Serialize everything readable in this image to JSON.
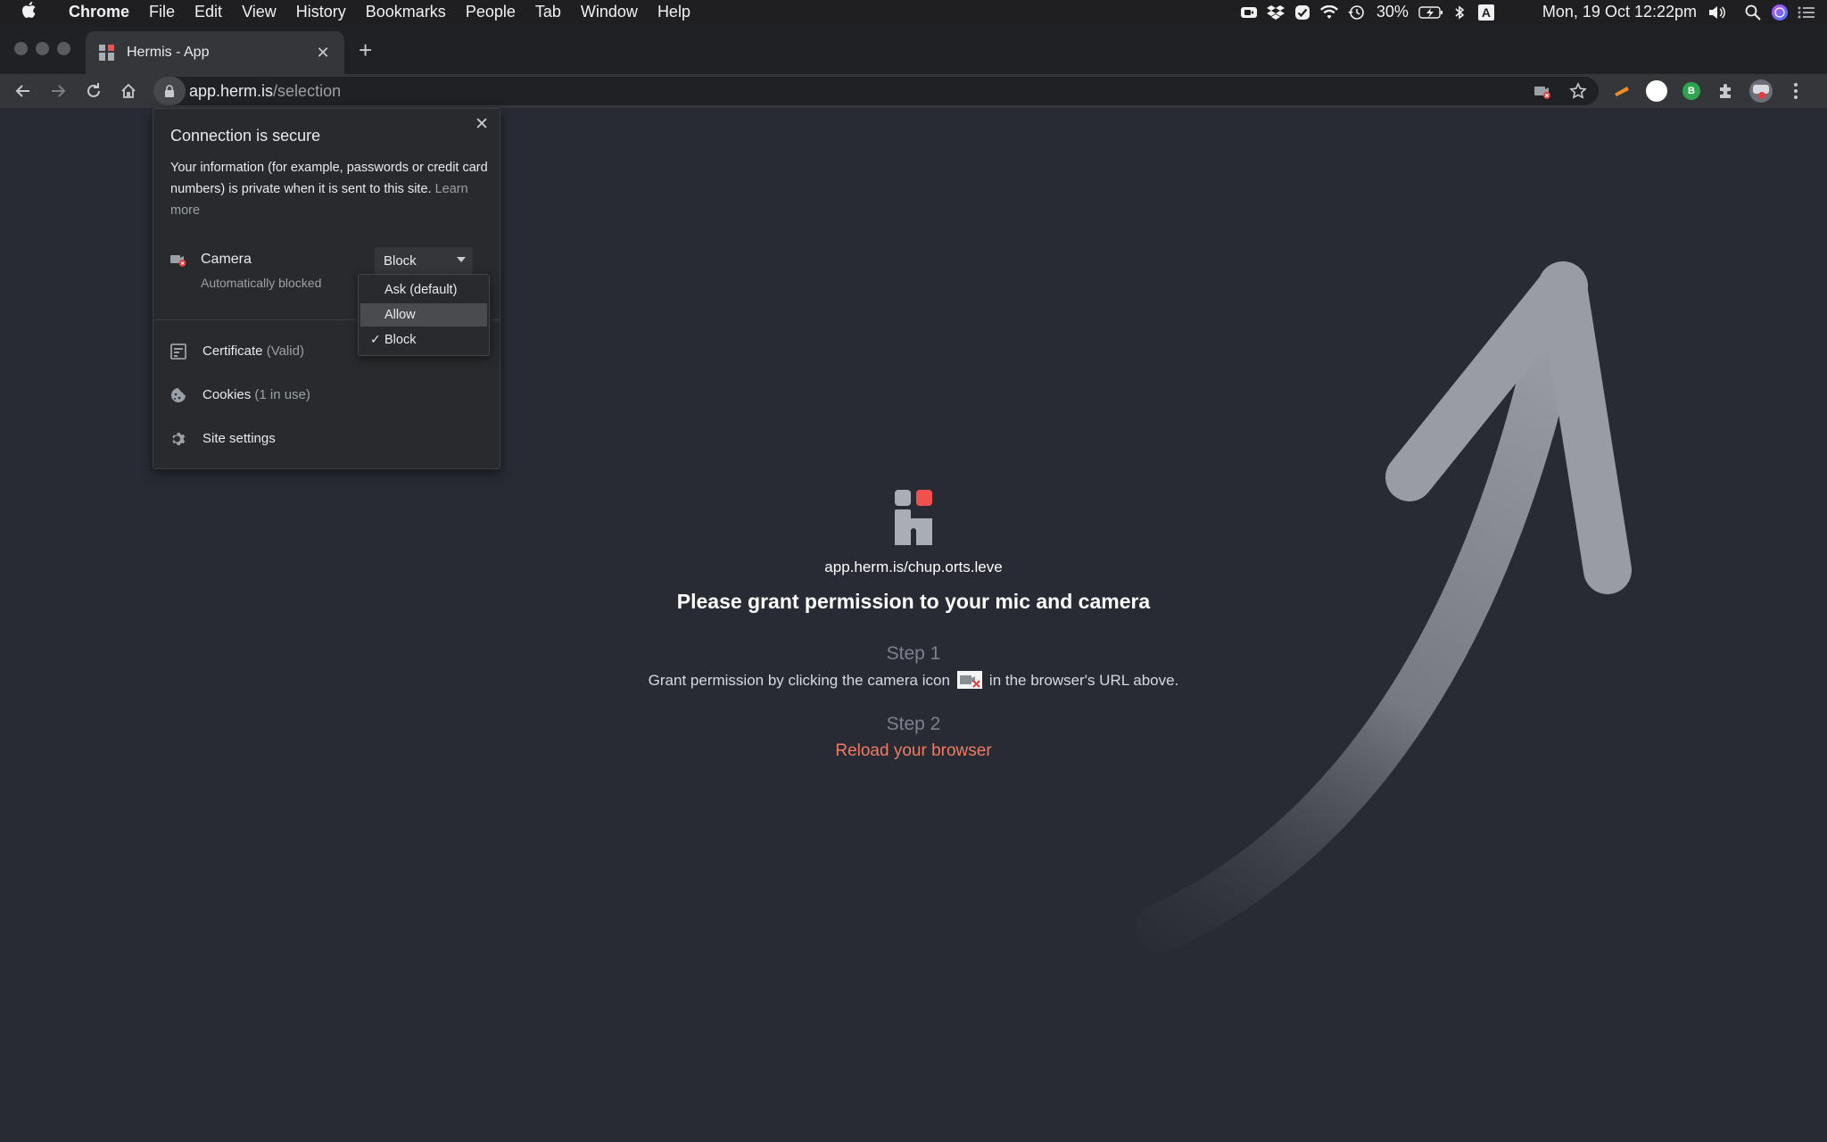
{
  "menubar": {
    "app": "Chrome",
    "items": [
      "File",
      "Edit",
      "View",
      "History",
      "Bookmarks",
      "People",
      "Tab",
      "Window",
      "Help"
    ],
    "battery": "30%",
    "datetime": "Mon, 19 Oct 12:22pm",
    "keyboard_indicator": "A",
    "status_icons": [
      "camera-icon",
      "dropbox-icon",
      "check-icon",
      "wifi-icon",
      "time-machine-icon",
      "battery-icon",
      "bluetooth-icon",
      "input-source-icon",
      "volume-icon",
      "spotlight-icon",
      "siri-icon",
      "notification-center-icon"
    ]
  },
  "browser": {
    "tab_title": "Hermis - App",
    "url_host": "app.herm.is",
    "url_path": "/selection"
  },
  "popup": {
    "title": "Connection is secure",
    "body": "Your information (for example, passwords or credit card numbers) is private when it is sent to this site.",
    "learn_more": "Learn more",
    "camera_label": "Camera",
    "camera_value": "Block",
    "camera_status": "Automatically blocked",
    "certificate_label": "Certificate",
    "certificate_sub": "(Valid)",
    "cookies_label": "Cookies",
    "cookies_sub": "(1 in use)",
    "site_settings_label": "Site settings",
    "options": [
      "Ask (default)",
      "Allow",
      "Block"
    ],
    "highlighted_option": "Allow",
    "selected_option": "Block"
  },
  "page": {
    "site_name": "app.herm.is/chup.orts.leve",
    "headline": "Please grant permission to your mic and camera",
    "step1_label": "Step 1",
    "step1_before": "Grant permission by clicking the camera icon",
    "step1_after": "in the browser's URL above.",
    "step2_label": "Step 2",
    "step2_text": "Reload your browser"
  },
  "colors": {
    "page_bg": "#282b34",
    "accent_red": "#f07a63",
    "logo_gray": "#a9adb6",
    "logo_red": "#f0514f"
  }
}
